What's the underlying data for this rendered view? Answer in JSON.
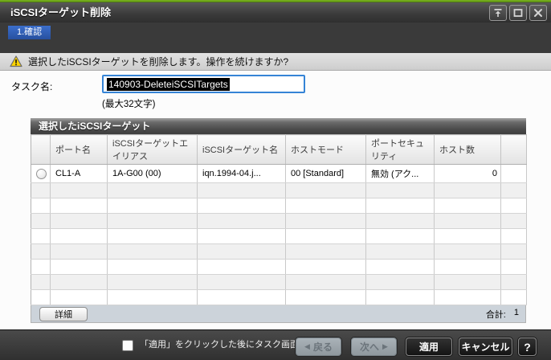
{
  "window": {
    "title": "iSCSIターゲット削除"
  },
  "tabs": {
    "confirm": "1.確認"
  },
  "warning": {
    "message": "選択したiSCSIターゲットを削除します。操作を続けますか?"
  },
  "task": {
    "label": "タスク名:",
    "value": "140903-DeleteiSCSITargets",
    "max_hint": "(最大32文字)"
  },
  "table": {
    "title": "選択したiSCSIターゲット",
    "columns": {
      "port": "ポート名",
      "alias": "iSCSIターゲットエイリアス",
      "target_name": "iSCSIターゲット名",
      "host_mode": "ホストモード",
      "port_security": "ポートセキュリティ",
      "host_count": "ホスト数"
    },
    "rows": [
      {
        "port": "CL1-A",
        "alias": "1A-G00 (00)",
        "target_name": "iqn.1994-04.j...",
        "host_mode": "00 [Standard]",
        "port_security": "無効 (アク...",
        "host_count": "0"
      }
    ],
    "detail_button_label": "詳細",
    "total_label": "合計:",
    "total_value": "1"
  },
  "footer": {
    "show_task_checkbox_label": "「適用」をクリックした後にタスク画面を表示",
    "back_label": "戻る",
    "next_label": "次へ",
    "apply_label": "適用",
    "cancel_label": "キャンセル",
    "help_label": "?",
    "back_arrow": "◀",
    "next_arrow": "▶"
  },
  "colors": {
    "accent_green": "#72aa1c",
    "tab_blue": "#2f5fba",
    "focus_blue": "#3584d6",
    "selection_bg": "#000000",
    "warning_yellow": "#ffd400",
    "bar_dark": "#3a3a3a"
  }
}
